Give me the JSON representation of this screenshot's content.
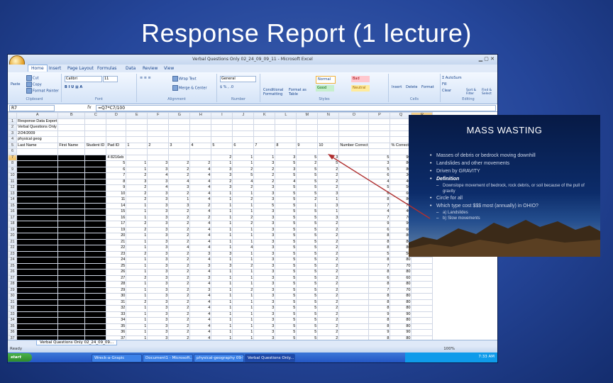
{
  "slide": {
    "title": "Response Report (1 lecture)"
  },
  "window": {
    "title": "Verbal Questions Only 02_24_09_09_11 - Microsoft Excel",
    "tabs": [
      "Home",
      "Insert",
      "Page Layout",
      "Formulas",
      "Data",
      "Review",
      "View"
    ]
  },
  "ribbon": {
    "paste": "Paste",
    "cut": "Cut",
    "copy": "Copy",
    "format_painter": "Format Painter",
    "clipboard": "Clipboard",
    "font_name": "Calibri",
    "font_size": "11",
    "font": "Font",
    "wrap_text": "Wrap Text",
    "merge_center": "Merge & Center",
    "alignment": "Alignment",
    "number_format": "General",
    "number": "Number",
    "conditional_formatting": "Conditional Formatting",
    "format_as_table": "Format as Table",
    "style_normal": "Normal",
    "style_bad": "Bad",
    "style_good": "Good",
    "style_neutral": "Neutral",
    "styles": "Styles",
    "insert": "Insert",
    "delete": "Delete",
    "format": "Format",
    "cells": "Cells",
    "autosum": "AutoSum",
    "fill": "Fill",
    "clear": "Clear",
    "sort_filter": "Sort & Filter",
    "find_select": "Find & Select",
    "editing": "Editing"
  },
  "formula_bar": {
    "name_box": "R7",
    "fx": "fx",
    "formula": "=Q7*C7/100"
  },
  "sheet": {
    "columns": [
      "A",
      "B",
      "C",
      "D",
      "E",
      "F",
      "G",
      "H",
      "I",
      "J",
      "K",
      "L",
      "M",
      "N",
      "O",
      "P",
      "Q",
      "R"
    ],
    "selected_column": "R",
    "rows": [
      {
        "n": "1",
        "cells": {
          "A": "Response Data Export"
        }
      },
      {
        "n": "2",
        "cells": {
          "A": "Verbal Questions Only"
        }
      },
      {
        "n": "3",
        "cells": {
          "A": "2/24/2009"
        }
      },
      {
        "n": "4",
        "cells": {
          "A": "physical geog"
        }
      },
      {
        "n": "5",
        "cells": {
          "A": "Last Name",
          "B": "First Name",
          "C": "Student ID",
          "D": "Pad ID",
          "E": "1",
          "F": "2",
          "G": "3",
          "H": "4",
          "I": "5",
          "J": "6",
          "K": "7",
          "L": "8",
          "M": "9",
          "N": "10",
          "O": "Number Correct",
          "Q": "% Correct"
        }
      },
      {
        "n": "6",
        "cells": {}
      },
      {
        "n": "7",
        "cells": {
          "D": "4 8216eb",
          "E": "",
          "F": "",
          "G": "",
          "H": "",
          "I": "2",
          "J": "1",
          "K": "1",
          "L": "3",
          "M": "5",
          "N": "3",
          "O": "",
          "P": "5",
          "Q": "90",
          "R": "1.5"
        }
      },
      {
        "n": "8",
        "cells": {
          "D": "5",
          "E": "1",
          "F": "3",
          "G": "2",
          "H": "2",
          "I": "1",
          "J": "1",
          "K": "3",
          "L": "5",
          "M": "2",
          "N": "5",
          "O": "",
          "P": "3",
          "Q": "80"
        }
      },
      {
        "n": "9",
        "cells": {
          "D": "6",
          "E": "1",
          "F": "3",
          "G": "2",
          "H": "4",
          "I": "3",
          "J": "2",
          "K": "2",
          "L": "3",
          "M": "5",
          "N": "2",
          "O": "",
          "P": "5",
          "Q": "80"
        }
      },
      {
        "n": "10",
        "cells": {
          "D": "7",
          "E": "2",
          "F": "4",
          "G": "2",
          "H": "4",
          "I": "3",
          "J": "5",
          "K": "2",
          "L": "5",
          "M": "5",
          "N": "2",
          "O": "",
          "P": "6",
          "Q": "30"
        }
      },
      {
        "n": "11",
        "cells": {
          "D": "8",
          "E": "3",
          "F": "3",
          "G": "4",
          "H": "4",
          "I": "2",
          "J": "4",
          "K": "2",
          "L": "4",
          "M": "5",
          "N": "2",
          "O": "",
          "P": "4",
          "Q": "40"
        }
      },
      {
        "n": "12",
        "cells": {
          "D": "9",
          "E": "2",
          "F": "4",
          "G": "3",
          "H": "4",
          "I": "3",
          "J": "2",
          "K": "3",
          "L": "5",
          "M": "5",
          "N": "2",
          "O": "",
          "P": "5",
          "Q": "50"
        }
      },
      {
        "n": "13",
        "cells": {
          "D": "10",
          "E": "2",
          "F": "3",
          "G": "2",
          "H": "4",
          "I": "1",
          "J": "1",
          "K": "3",
          "L": "5",
          "M": "5",
          "N": "3",
          "O": "",
          "P": "6",
          "Q": "60"
        }
      },
      {
        "n": "14",
        "cells": {
          "D": "11",
          "E": "2",
          "F": "3",
          "G": "1",
          "H": "4",
          "I": "1",
          "J": "2",
          "K": "3",
          "L": "5",
          "M": "2",
          "N": "1",
          "O": "",
          "P": "8",
          "Q": "80"
        }
      },
      {
        "n": "15",
        "cells": {
          "D": "14",
          "E": "1",
          "F": "3",
          "G": "3",
          "H": "2",
          "I": "1",
          "J": "1",
          "K": "5",
          "L": "5",
          "M": "1",
          "N": "3",
          "O": "",
          "P": "7",
          "Q": "70"
        }
      },
      {
        "n": "16",
        "cells": {
          "D": "15",
          "E": "1",
          "F": "3",
          "G": "2",
          "H": "4",
          "I": "1",
          "J": "1",
          "K": "3",
          "L": "5",
          "M": "5",
          "N": "1",
          "O": "",
          "P": "4",
          "Q": "40"
        }
      },
      {
        "n": "17",
        "cells": {
          "D": "16",
          "E": "1",
          "F": "3",
          "G": "2",
          "H": "2",
          "I": "1",
          "J": "2",
          "K": "3",
          "L": "5",
          "M": "5",
          "N": "3",
          "O": "",
          "P": "7",
          "Q": "70"
        }
      },
      {
        "n": "18",
        "cells": {
          "D": "17",
          "E": "2",
          "F": "3",
          "G": "2",
          "H": "4",
          "I": "1",
          "J": "2",
          "K": "3",
          "L": "5",
          "M": "5",
          "N": "2",
          "O": "",
          "P": "9",
          "Q": "90"
        }
      },
      {
        "n": "19",
        "cells": {
          "D": "19",
          "E": "2",
          "F": "3",
          "G": "2",
          "H": "4",
          "I": "1",
          "J": "1",
          "K": "3",
          "L": "5",
          "M": "5",
          "N": "2",
          "O": "",
          "P": "6",
          "Q": "60"
        }
      },
      {
        "n": "20",
        "cells": {
          "D": "20",
          "E": "1",
          "F": "3",
          "G": "2",
          "H": "4",
          "I": "1",
          "J": "1",
          "K": "3",
          "L": "5",
          "M": "5",
          "N": "2",
          "O": "",
          "P": "8",
          "Q": "80"
        }
      },
      {
        "n": "21",
        "cells": {
          "D": "21",
          "E": "1",
          "F": "3",
          "G": "2",
          "H": "4",
          "I": "1",
          "J": "1",
          "K": "3",
          "L": "5",
          "M": "5",
          "N": "2",
          "O": "",
          "P": "8",
          "Q": "80"
        }
      },
      {
        "n": "22",
        "cells": {
          "D": "22",
          "E": "1",
          "F": "3",
          "G": "4",
          "H": "4",
          "I": "1",
          "J": "4",
          "K": "3",
          "L": "5",
          "M": "5",
          "N": "2",
          "O": "",
          "P": "8",
          "Q": "80"
        }
      },
      {
        "n": "23",
        "cells": {
          "D": "23",
          "E": "2",
          "F": "3",
          "G": "2",
          "H": "3",
          "I": "3",
          "J": "1",
          "K": "3",
          "L": "5",
          "M": "5",
          "N": "2",
          "O": "",
          "P": "5",
          "Q": "50"
        }
      },
      {
        "n": "24",
        "cells": {
          "D": "24",
          "E": "1",
          "F": "3",
          "G": "2",
          "H": "4",
          "I": "1",
          "J": "1",
          "K": "3",
          "L": "5",
          "M": "5",
          "N": "2",
          "O": "",
          "P": "8",
          "Q": "80"
        }
      },
      {
        "n": "25",
        "cells": {
          "D": "25",
          "E": "1",
          "F": "3",
          "G": "2",
          "H": "3",
          "I": "3",
          "J": "2",
          "K": "3",
          "L": "5",
          "M": "5",
          "N": "2",
          "O": "",
          "P": "7",
          "Q": "70"
        }
      },
      {
        "n": "26",
        "cells": {
          "D": "26",
          "E": "1",
          "F": "3",
          "G": "2",
          "H": "4",
          "I": "1",
          "J": "1",
          "K": "3",
          "L": "5",
          "M": "5",
          "N": "2",
          "O": "",
          "P": "8",
          "Q": "80"
        }
      },
      {
        "n": "27",
        "cells": {
          "D": "27",
          "E": "2",
          "F": "3",
          "G": "2",
          "H": "3",
          "I": "1",
          "J": "1",
          "K": "3",
          "L": "5",
          "M": "5",
          "N": "2",
          "O": "",
          "P": "6",
          "Q": "60"
        }
      },
      {
        "n": "28",
        "cells": {
          "D": "28",
          "E": "1",
          "F": "3",
          "G": "2",
          "H": "4",
          "I": "1",
          "J": "1",
          "K": "3",
          "L": "5",
          "M": "5",
          "N": "2",
          "O": "",
          "P": "8",
          "Q": "80"
        }
      },
      {
        "n": "29",
        "cells": {
          "D": "29",
          "E": "1",
          "F": "3",
          "G": "2",
          "H": "3",
          "I": "1",
          "J": "2",
          "K": "3",
          "L": "5",
          "M": "5",
          "N": "2",
          "O": "",
          "P": "7",
          "Q": "70"
        }
      },
      {
        "n": "30",
        "cells": {
          "D": "30",
          "E": "1",
          "F": "3",
          "G": "2",
          "H": "4",
          "I": "1",
          "J": "1",
          "K": "3",
          "L": "5",
          "M": "5",
          "N": "2",
          "O": "",
          "P": "8",
          "Q": "80"
        }
      },
      {
        "n": "31",
        "cells": {
          "D": "31",
          "E": "2",
          "F": "3",
          "G": "2",
          "H": "4",
          "I": "1",
          "J": "1",
          "K": "3",
          "L": "5",
          "M": "5",
          "N": "2",
          "O": "",
          "P": "8",
          "Q": "80"
        }
      },
      {
        "n": "32",
        "cells": {
          "D": "32",
          "E": "1",
          "F": "3",
          "G": "2",
          "H": "4",
          "I": "1",
          "J": "1",
          "K": "3",
          "L": "5",
          "M": "5",
          "N": "2",
          "O": "",
          "P": "8",
          "Q": "80"
        }
      },
      {
        "n": "33",
        "cells": {
          "D": "33",
          "E": "1",
          "F": "3",
          "G": "2",
          "H": "4",
          "I": "1",
          "J": "1",
          "K": "3",
          "L": "5",
          "M": "5",
          "N": "2",
          "O": "",
          "P": "9",
          "Q": "90"
        }
      },
      {
        "n": "34",
        "cells": {
          "D": "34",
          "E": "1",
          "F": "3",
          "G": "2",
          "H": "4",
          "I": "1",
          "J": "1",
          "K": "3",
          "L": "5",
          "M": "5",
          "N": "2",
          "O": "",
          "P": "8",
          "Q": "80"
        }
      },
      {
        "n": "35",
        "cells": {
          "D": "35",
          "E": "1",
          "F": "3",
          "G": "2",
          "H": "4",
          "I": "1",
          "J": "1",
          "K": "3",
          "L": "5",
          "M": "5",
          "N": "2",
          "O": "",
          "P": "8",
          "Q": "80"
        }
      },
      {
        "n": "36",
        "cells": {
          "D": "36",
          "E": "1",
          "F": "3",
          "G": "2",
          "H": "4",
          "I": "1",
          "J": "1",
          "K": "3",
          "L": "5",
          "M": "5",
          "N": "2",
          "O": "",
          "P": "9",
          "Q": "90"
        }
      },
      {
        "n": "37",
        "cells": {
          "D": "37",
          "E": "1",
          "F": "3",
          "G": "2",
          "H": "4",
          "I": "1",
          "J": "1",
          "K": "3",
          "L": "5",
          "M": "5",
          "N": "2",
          "O": "",
          "P": "8",
          "Q": "80"
        }
      },
      {
        "n": "38",
        "cells": {
          "D": "38",
          "E": "1",
          "F": "3",
          "G": "2",
          "H": "4",
          "I": "1",
          "J": "1",
          "K": "3",
          "L": "5",
          "M": "5",
          "N": "2",
          "O": "",
          "P": "8",
          "Q": "80"
        }
      }
    ],
    "sheet_tab": "Verbal Questions Only 02_24_09_09...",
    "status": "Ready",
    "zoom": "100%"
  },
  "taskbar": {
    "start": "start",
    "items": [
      "Wreck-a-Grapic",
      "Document1 - Microsoft...",
      "physical-geography 09-5...",
      "Verbal Questions Only..."
    ],
    "active_index": 3,
    "clock": "7:33 AM"
  },
  "inset": {
    "title": "MASS WASTING",
    "bullets": [
      {
        "text": "Masses of debris or bedrock moving downhill",
        "kind": "main"
      },
      {
        "text": "Landslides and other movements",
        "kind": "main"
      },
      {
        "text": "Driven by GRAVITY",
        "kind": "main"
      },
      {
        "text": "Definition",
        "kind": "def"
      },
      {
        "text": "Downslope movement of bedrock, rock debris, or soil because of the pull of gravity",
        "kind": "sub"
      },
      {
        "text": "Circle for all",
        "kind": "main"
      },
      {
        "text": "Which type cost $$$ most (annually) in OHIO?",
        "kind": "main"
      },
      {
        "text": "a) Landslides",
        "kind": "sub"
      },
      {
        "text": "b) Slow movements",
        "kind": "sub"
      }
    ]
  },
  "colors": {
    "slide_bg": "#25469a",
    "inset_bg": "#0c2c6a",
    "arrow": "#b03030"
  }
}
